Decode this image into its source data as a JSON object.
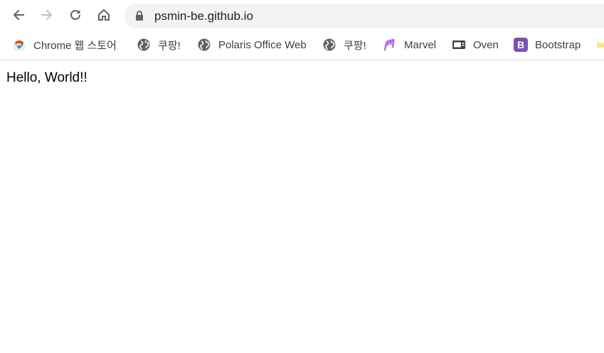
{
  "browser": {
    "url": "psmin-be.github.io",
    "nav": {
      "back_icon": "arrow-left-icon",
      "forward_icon": "arrow-right-icon",
      "reload_icon": "reload-icon",
      "home_icon": "home-icon",
      "lock_icon": "lock-icon"
    }
  },
  "bookmarks": [
    {
      "label": "Chrome 웹 스토어",
      "icon": "chrome-webstore-icon"
    },
    {
      "label": "쿠팡!",
      "icon": "globe-icon"
    },
    {
      "label": "Polaris Office Web",
      "icon": "globe-icon"
    },
    {
      "label": "쿠팡!",
      "icon": "globe-icon"
    },
    {
      "label": "Marvel",
      "icon": "marvel-icon"
    },
    {
      "label": "Oven",
      "icon": "oven-icon"
    },
    {
      "label": "Bootstrap",
      "icon": "bootstrap-icon"
    },
    {
      "label": "",
      "icon": "folder-icon"
    }
  ],
  "page": {
    "text": "Hello, World!!"
  },
  "colors": {
    "omnibox_bg": "#f1f3f4",
    "icon_gray": "#5f6368",
    "bootstrap_purple": "#7952b3",
    "marvel_purple": "#b86ce0",
    "folder_yellow": "#fce588"
  }
}
